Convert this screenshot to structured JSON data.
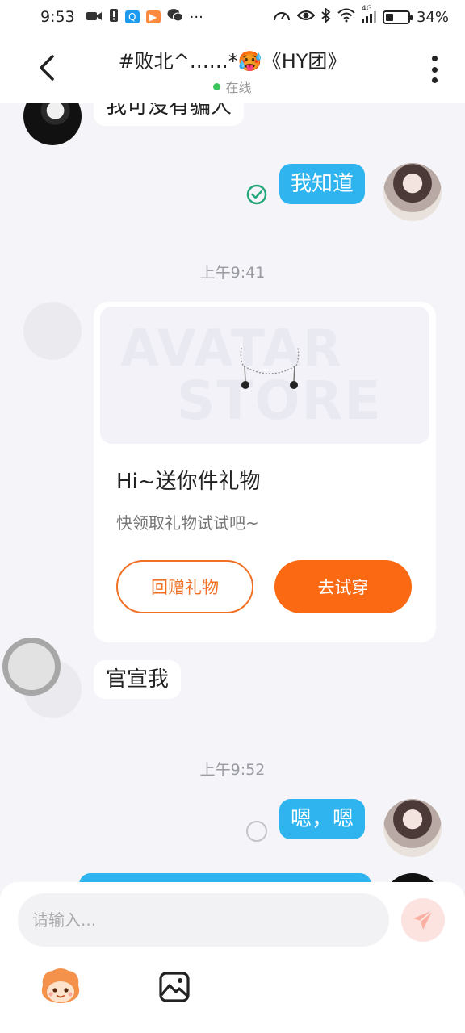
{
  "status_bar": {
    "time": "9:53",
    "network": "4G",
    "battery": "34%",
    "icons": [
      "video-icon",
      "alert-icon",
      "q-app-icon",
      "play-icon",
      "wechat-icon",
      "more-dots-icon"
    ]
  },
  "header": {
    "title": "#败北^……*🥵《HY团》",
    "status": "在线"
  },
  "messages": [
    {
      "side": "left",
      "text": "我可没有骗人"
    },
    {
      "side": "right",
      "text": "我知道",
      "state": "read"
    },
    {
      "type": "time",
      "text": "上午9:41"
    },
    {
      "type": "gift",
      "watermark_line1": "AVATAR",
      "watermark_line2": "STORE",
      "title": "Hi~送你件礼物",
      "subtitle": "快领取礼物试试吧~",
      "btn_return": "回赠礼物",
      "btn_try": "去试穿"
    },
    {
      "side": "left",
      "text": "官宣我"
    },
    {
      "type": "time",
      "text": "上午9:52"
    },
    {
      "side": "right",
      "text": "嗯，嗯",
      "state": "sending"
    }
  ],
  "input": {
    "placeholder": "请输入..."
  },
  "colors": {
    "accent_blue": "#2fb4f0",
    "accent_orange": "#fb6a12",
    "online_green": "#3ac55c",
    "read_green": "#26a87a"
  }
}
